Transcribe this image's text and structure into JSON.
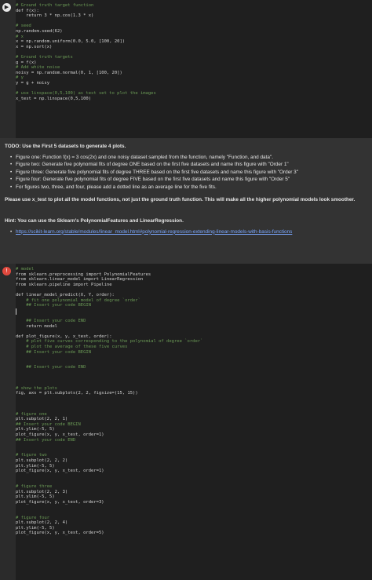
{
  "cell1": {
    "lines": [
      "# Ground truth target function",
      "def f(x):",
      "    return 3 * np.cos(1.3 * x)",
      "",
      "# seed",
      "np.random.seed(62)",
      "# x",
      "x = np.random.uniform(0.0, 5.0, [100, 20])",
      "x = np.sort(x)",
      "",
      "# Ground truth targets",
      "g = f(x)",
      "# Add white noise",
      "noisy = np.random.normal(0, 1, [100, 20])",
      "# y",
      "y = g + noisy",
      "",
      "# use linspace(0,5,100) as test set to plot the images",
      "x_test = np.linspace(0,5,100)"
    ]
  },
  "text": {
    "todo_title": "TODO: Use the First 5 datasets to generate 4 plots.",
    "bullets": [
      "Figure one: Function f(x) = 3 cos(2x) and one noisy dataset sampled from the function, namely \"Function, and data\".",
      "Figure two: Generate five polynomial fits of degree ONE based on the first five datasets and name this figure with \"Order 1\"",
      "Figure three: Generate five polynomial fits of degree THREE based on the first five datasets and name this figure with \"Order 3\"",
      "Figure four: Generate five polynomial fits of degree FIVE based on the first five datasets and name this figure with \"Order 5\"",
      "For figures two, three, and four, please add a dotted line as an average line for the five fits."
    ],
    "note": "Please use x_test to plot all the model functions, not just the ground truth function. This will make all the higher polynomial models look smoother.",
    "hint": "Hint: You can use the Sklearn's PolynomialFeatures and LinearRegression.",
    "link": "https://scikit-learn.org/stable/modules/linear_model.html#polynomial-regression-extending-linear-models-with-basis-functions"
  },
  "cell2": {
    "lines": [
      "# model",
      "from sklearn.preprocessing import PolynomialFeatures",
      "from sklearn.linear_model import LinearRegression",
      "from sklearn.pipeline import Pipeline",
      "",
      "def linear_model_predict(X, Y, order):",
      "    # fit one polynomial model of degree `order`",
      "    ## Insert your code BEGIN",
      "",
      "",
      "    ## Insert your code END",
      "    return model",
      "",
      "def plot_figure(x, y, x_test, order):",
      "    # plot five curves corresponding to the polynomial of degree `order`",
      "    # plot the average of these five curves",
      "    ## Insert your code BEGIN",
      "",
      "",
      "    ## Insert your code END",
      "",
      "",
      "",
      "# show the plots",
      "fig, axs = plt.subplots(2, 2, figsize=(15, 15))",
      "",
      "",
      "",
      "# figure one",
      "plt.subplot(2, 2, 1)",
      "## Insert your code BEGIN",
      "plt.ylim(-5, 5)",
      "plot_figure(x, y, x_test, order=1)",
      "## Insert your code END",
      "",
      "",
      "# figure two",
      "plt.subplot(2, 2, 2)",
      "plt.ylim(-5, 5)",
      "plot_figure(x, y, x_test, order=1)",
      "",
      "",
      "# figure three",
      "plt.subplot(2, 2, 3)",
      "plt.ylim(-5, 5)",
      "plot_figure(x, y, x_test, order=3)",
      "",
      "",
      "# figure four",
      "plt.subplot(2, 2, 4)",
      "plt.ylim(-5, 5)",
      "plot_figure(x, y, x_test, order=5)"
    ]
  },
  "icons": {
    "run": "play-icon",
    "error": "error-icon"
  }
}
